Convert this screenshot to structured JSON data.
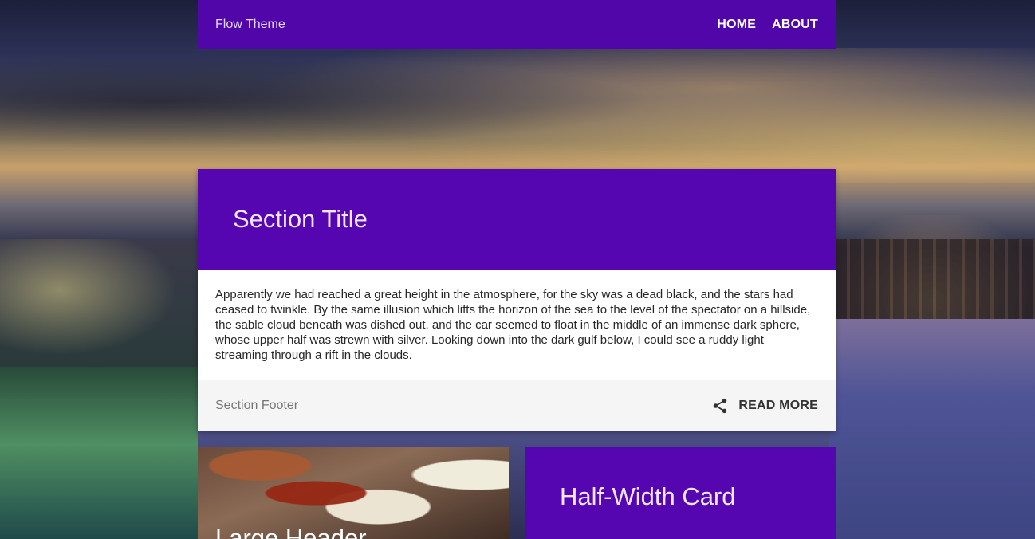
{
  "header": {
    "brand": "Flow Theme",
    "nav": [
      {
        "label": "HOME"
      },
      {
        "label": "ABOUT"
      }
    ]
  },
  "section_card": {
    "title": "Section Title",
    "body": "Apparently we had reached a great height in the atmosphere, for the sky was a dead black, and the stars had ceased to twinkle. By the same illusion which lifts the horizon of the sea to the level of the spectator on a hillside, the sable cloud beneath was dished out, and the car seemed to float in the middle of an immense dark sphere, whose upper half was strewn with silver. Looking down into the dark gulf below, I could see a ruddy light streaming through a rift in the clouds.",
    "footer_label": "Section Footer",
    "share_icon": "share-icon",
    "read_more_label": "READ MORE"
  },
  "image_card": {
    "title": "Large Header"
  },
  "half_card": {
    "title": "Half-Width Card"
  },
  "colors": {
    "accent": "#5506b0",
    "topbar": "#5006a8",
    "footer_bg": "#f5f5f5"
  }
}
